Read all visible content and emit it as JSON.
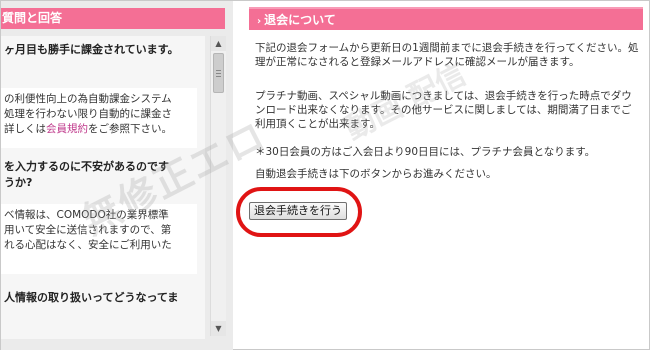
{
  "left": {
    "header": "質問と回答",
    "q1": "ヶ月目も勝手に課金されています。",
    "a1_line1": "の利便性向上の為自動課金システム",
    "a1_line2": "処理を行わない限り自動的に課金さ",
    "a1_line3_pre": "詳しくは",
    "a1_line3_link": "会員規約",
    "a1_line3_post": "をご参照下さい。",
    "q2_line1": "を入力するのに不安があるのです",
    "q2_line2": "うか?",
    "a2_line1": "ベ情報は、COMODO社の業界標準",
    "a2_line2": "用いて安全に送信されますので、第",
    "a2_line3": "れる心配はなく、安全にご利用いた",
    "q3": "人情報の取り扱いってどうなってま"
  },
  "right": {
    "header_arrow": "›",
    "header": "退会について",
    "p1": "下記の退会フォームから更新日の1週間前までに退会手続きを行ってください。処理が正常になされると登録メールアドレスに確認メールが届きます。",
    "p2": "プラチナ動画、スペシャル動画につきましては、退会手続きを行った時点でダウンロード出来なくなります。その他サービスに関しましては、期間満了日までご利用頂くことが出来ます。",
    "p3": "＊30日会員の方はご入会日より90日目には、プラチナ会員となります。",
    "p4": "自動退会手続きは下のボタンからお進みください。",
    "button": "退会手続きを行う"
  },
  "scrollbar": {
    "up": "▲",
    "down": "▼"
  },
  "watermark": {
    "text1": "無修正エロ",
    "text2": "動画 配信"
  }
}
